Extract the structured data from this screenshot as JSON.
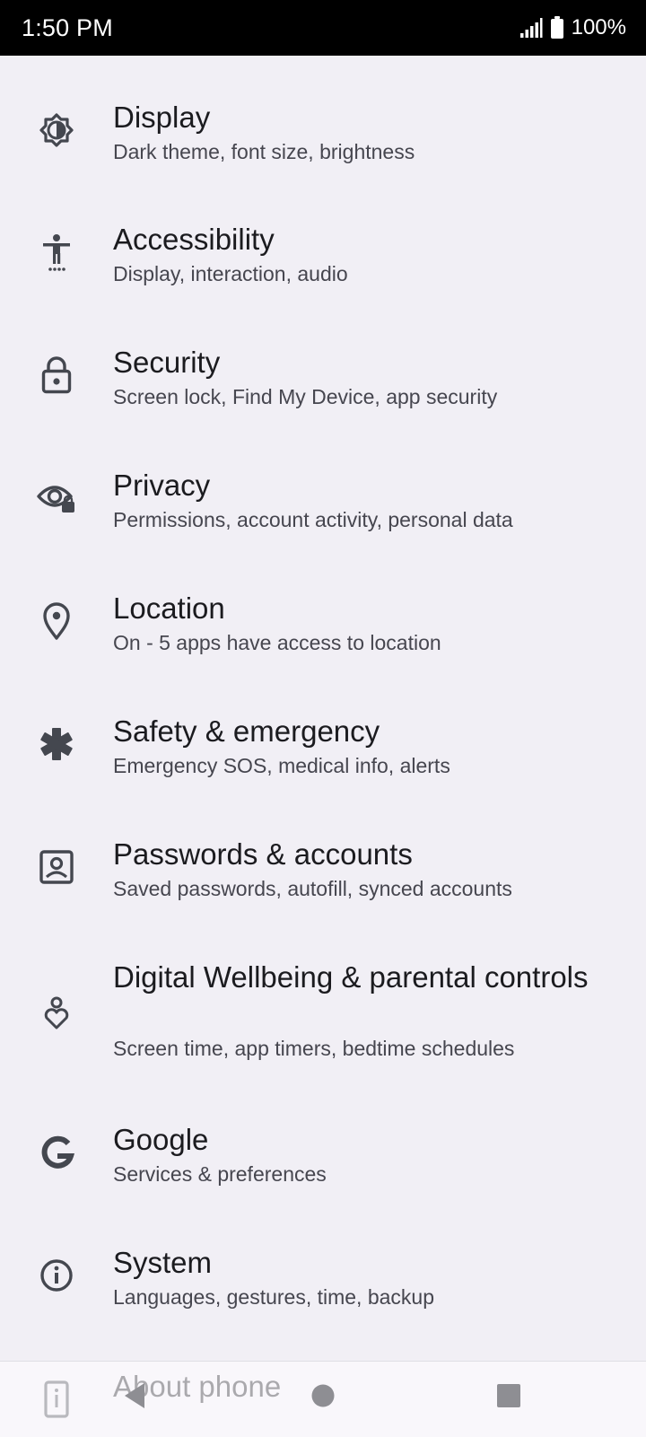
{
  "status_bar": {
    "time": "1:50 PM",
    "battery": "100%",
    "icons": [
      "signal-icon",
      "battery-icon"
    ]
  },
  "settings": {
    "items": [
      {
        "title": "Display",
        "summary": "Dark theme, font size, brightness",
        "icon": "display-brightness-icon"
      },
      {
        "title": "Accessibility",
        "summary": "Display, interaction, audio",
        "icon": "accessibility-icon"
      },
      {
        "title": "Security",
        "summary": "Screen lock, Find My Device, app security",
        "icon": "lock-icon"
      },
      {
        "title": "Privacy",
        "summary": "Permissions, account activity, personal data",
        "icon": "privacy-eye-icon"
      },
      {
        "title": "Location",
        "summary": "On - 5 apps have access to location",
        "icon": "location-pin-icon"
      },
      {
        "title": "Safety & emergency",
        "summary": "Emergency SOS, medical info, alerts",
        "icon": "emergency-asterisk-icon"
      },
      {
        "title": "Passwords & accounts",
        "summary": "Saved passwords, autofill, synced accounts",
        "icon": "account-box-icon"
      },
      {
        "title": "Digital Wellbeing & parental controls",
        "summary": "Screen time, app timers, bedtime schedules",
        "icon": "wellbeing-icon"
      },
      {
        "title": "Google",
        "summary": "Services & preferences",
        "icon": "google-g-icon"
      },
      {
        "title": "System",
        "summary": "Languages, gestures, time, backup",
        "icon": "info-icon"
      }
    ],
    "partial_item": {
      "title": "About phone",
      "icon": "phone-icon"
    }
  },
  "nav_bar": {
    "buttons": [
      "back-icon",
      "home-icon",
      "recents-icon"
    ]
  },
  "colors": {
    "background": "#f1eff5",
    "status_bar": "#000000",
    "title_text": "#1b1b1f",
    "summary_text": "#46464f",
    "icon": "#44474f",
    "nav_button": "#8e8e93"
  }
}
